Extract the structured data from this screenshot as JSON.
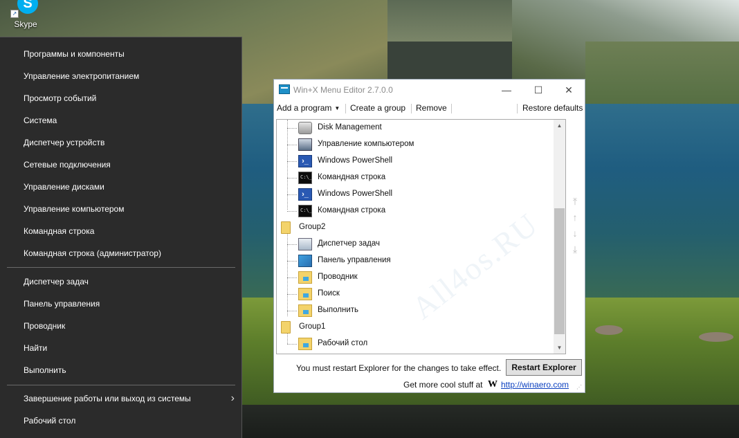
{
  "desktop": {
    "icons": [
      {
        "label": "Skype",
        "icon": "skype-icon"
      }
    ],
    "watermark": "All4os.RU"
  },
  "winx_menu": {
    "items": [
      {
        "label": "Программы и компоненты"
      },
      {
        "label": "Управление электропитанием"
      },
      {
        "label": "Просмотр событий"
      },
      {
        "label": "Система"
      },
      {
        "label": "Диспетчер устройств"
      },
      {
        "label": "Сетевые подключения"
      },
      {
        "label": "Управление дисками"
      },
      {
        "label": "Управление компьютером"
      },
      {
        "label": "Командная строка"
      },
      {
        "label": "Командная строка (администратор)"
      },
      {
        "label": "Диспетчер задач"
      },
      {
        "label": "Панель управления"
      },
      {
        "label": "Проводник"
      },
      {
        "label": "Найти"
      },
      {
        "label": "Выполнить"
      },
      {
        "label": "Завершение работы или выход из системы"
      },
      {
        "label": "Рабочий стол"
      }
    ],
    "submenu_icon": "chevron-right-icon"
  },
  "editor": {
    "title": "Win+X Menu Editor 2.7.0.0",
    "window_controls": {
      "minimize": "—",
      "maximize": "☐",
      "close": "✕"
    },
    "toolbar": {
      "add_program": "Add a program",
      "create_group": "Create a group",
      "remove": "Remove",
      "restore_defaults": "Restore defaults"
    },
    "tree": [
      {
        "label": "Disk Management",
        "icon": "disk-management-icon"
      },
      {
        "label": "Управление компьютером",
        "icon": "computer-management-icon"
      },
      {
        "label": "Windows PowerShell",
        "icon": "powershell-icon"
      },
      {
        "label": "Командная строка",
        "icon": "command-prompt-icon"
      },
      {
        "label": "Windows PowerShell",
        "icon": "powershell-icon"
      },
      {
        "label": "Командная строка",
        "icon": "command-prompt-icon"
      },
      {
        "label": "Group2",
        "icon": "folder-icon"
      },
      {
        "label": "Диспетчер задач",
        "icon": "task-manager-icon"
      },
      {
        "label": "Панель управления",
        "icon": "control-panel-icon"
      },
      {
        "label": "Проводник",
        "icon": "shortcut-folder-icon"
      },
      {
        "label": "Поиск",
        "icon": "shortcut-folder-icon"
      },
      {
        "label": "Выполнить",
        "icon": "shortcut-folder-icon"
      },
      {
        "label": "Group1",
        "icon": "folder-icon"
      },
      {
        "label": "Рабочий стол",
        "icon": "shortcut-folder-icon"
      }
    ],
    "restart_note": "You must restart Explorer for the changes to take effect.",
    "restart_button": "Restart Explorer",
    "promo_text": "Get more cool stuff at",
    "promo_logo": "W",
    "promo_link": "http://winaero.com"
  },
  "colors": {
    "menu_bg": "#2b2b2b",
    "menu_text": "#ffffff",
    "link": "#0a3fbf"
  }
}
